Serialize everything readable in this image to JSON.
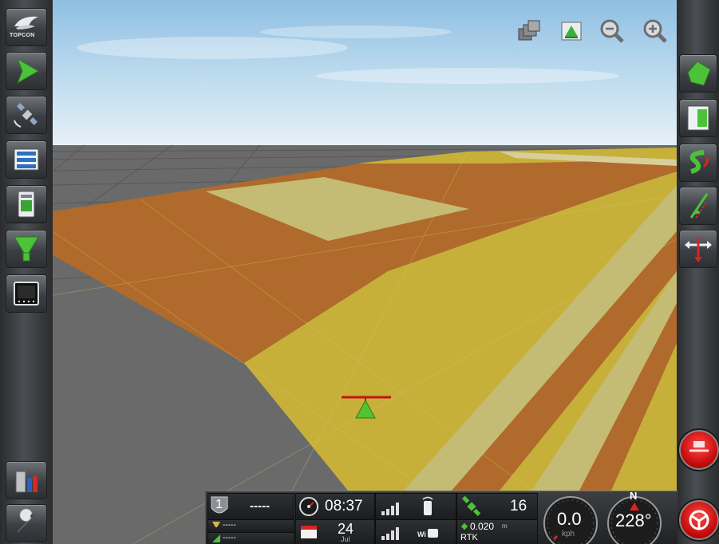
{
  "brand": {
    "logo_text": "TOPCON"
  },
  "left_toolbar": {
    "items": [
      {
        "name": "topcon-logo-button",
        "icon": "topcon-logo-icon"
      },
      {
        "name": "guidance-button",
        "icon": "green-arrow-icon"
      },
      {
        "name": "gps-receiver-button",
        "icon": "satellite-icon"
      },
      {
        "name": "field-menu-button",
        "icon": "list-icon"
      },
      {
        "name": "implement-button",
        "icon": "controller-icon"
      },
      {
        "name": "seed-rate-button",
        "icon": "funnel-icon"
      },
      {
        "name": "display-settings-button",
        "icon": "screen-icon"
      },
      {
        "name": "job-button",
        "icon": "paint-bins-icon"
      },
      {
        "name": "settings-button",
        "icon": "wrench-icon"
      }
    ]
  },
  "right_toolbar": {
    "items": [
      {
        "name": "field-boundary-button",
        "icon": "field-icon"
      },
      {
        "name": "headland-button",
        "icon": "headland-flag-icon"
      },
      {
        "name": "curve-line-button",
        "icon": "s-curve-icon"
      },
      {
        "name": "nudge-line-button",
        "icon": "guideline-icon"
      },
      {
        "name": "shift-button",
        "icon": "shift-arrows-icon"
      }
    ]
  },
  "map_tools": [
    {
      "name": "layers-button",
      "icon": "layers-icon"
    },
    {
      "name": "field-view-button",
      "icon": "field-view-icon"
    },
    {
      "name": "zoom-out-button",
      "icon": "zoom-out-icon"
    },
    {
      "name": "zoom-in-button",
      "icon": "zoom-in-icon"
    }
  ],
  "status": {
    "section_number": "1",
    "section_value": "-----",
    "product_a": "-----",
    "product_b": "-----",
    "time": "08:37",
    "date_day": "24",
    "date_month": "Jul",
    "satellites": "16",
    "accuracy": "0.020",
    "accuracy_unit": "m",
    "correction": "RTK",
    "speed_value": "0.0",
    "speed_unit": "kph",
    "heading_value": "228°",
    "compass_north": "N"
  },
  "colors": {
    "sky_top": "#a9cde8",
    "sky_bottom": "#e2eef6",
    "ground": "#6b6b6b",
    "coverage_orange": "#b36c2a",
    "coverage_yellow": "#c9b43b",
    "coverage_light": "#c6bd78",
    "alert_red": "#d21010"
  }
}
